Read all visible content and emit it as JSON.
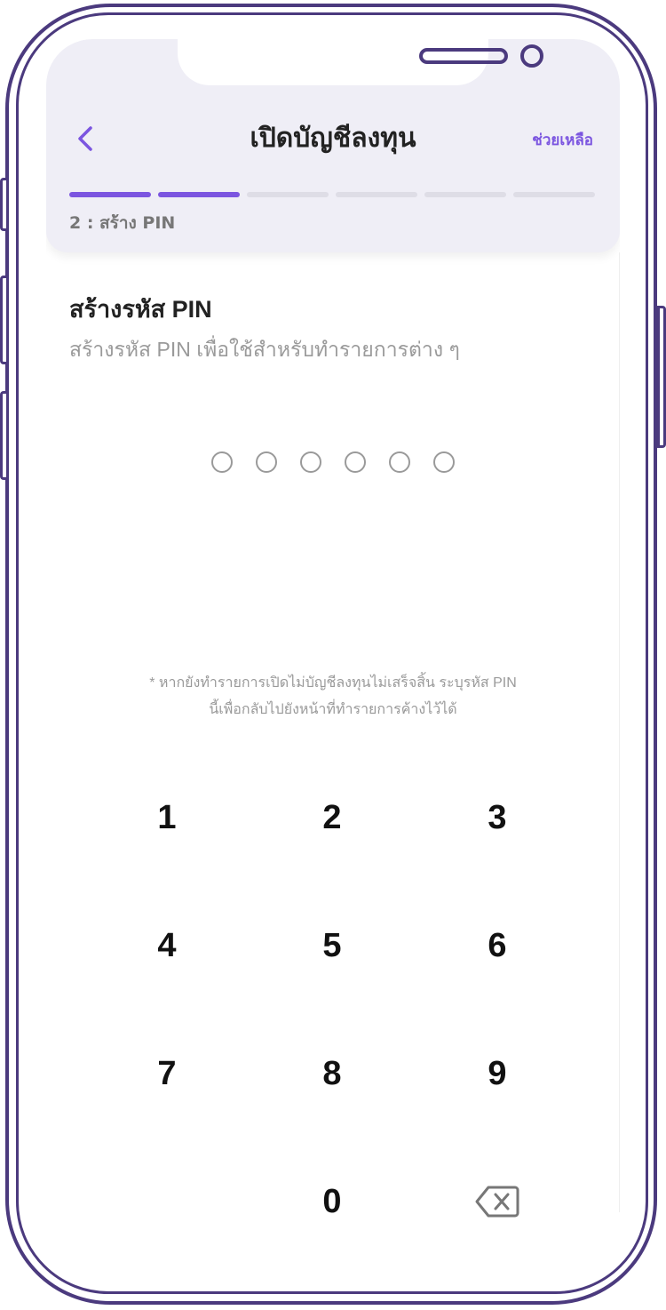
{
  "header": {
    "title": "เปิดบัญชีลงทุน",
    "help_label": "ช่วยเหลือ",
    "back_icon": "chevron-left-icon",
    "step_label": "2 : สร้าง PIN",
    "progress": {
      "total_steps": 6,
      "current_step": 2
    }
  },
  "main": {
    "title": "สร้างรหัส PIN",
    "subtitle": "สร้างรหัส PIN เพื่อใช้สำหรับทำรายการต่าง ๆ",
    "pin_length": 6,
    "pin_entered": 0,
    "note_line1": "* หากยังทำรายการเปิดไม่บัญชีลงทุนไม่เสร็จสิ้น ระบุรหัส PIN",
    "note_line2": "นี้เพื่อกลับไปยังหน้าที่ทำรายการค้างไว้ได้"
  },
  "keypad": {
    "keys": [
      "1",
      "2",
      "3",
      "4",
      "5",
      "6",
      "7",
      "8",
      "9",
      "0"
    ],
    "delete_icon": "backspace-icon"
  },
  "colors": {
    "accent": "#7b55e0",
    "header_bg": "#efeef6",
    "frame": "#4b3a7e"
  }
}
